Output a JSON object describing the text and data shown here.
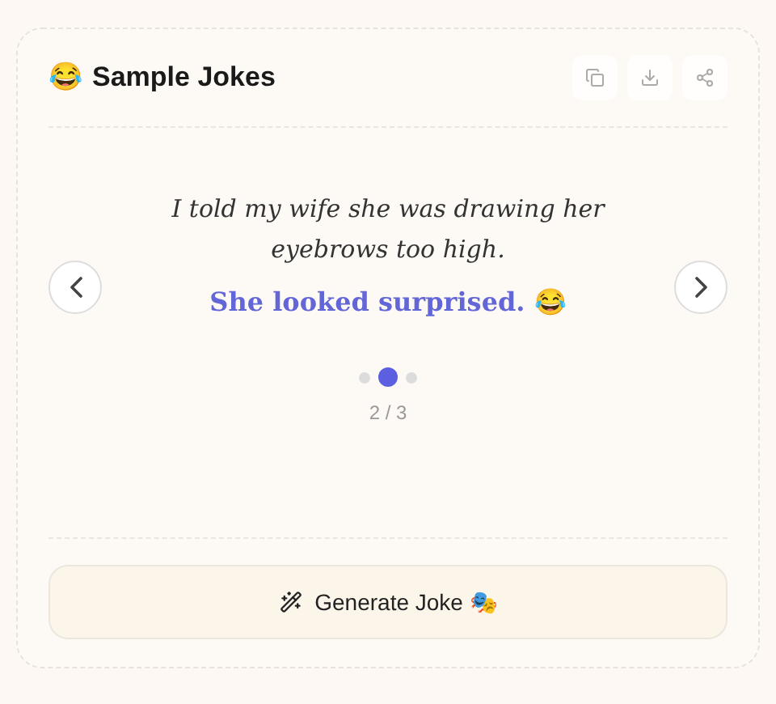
{
  "header": {
    "emoji": "😂",
    "title": "Sample Jokes"
  },
  "joke": {
    "setup": "I told my wife she was drawing her eyebrows too high.",
    "punchline": "She looked surprised. 😂"
  },
  "dots": [
    {
      "selected": false
    },
    {
      "selected": true
    },
    {
      "selected": false
    }
  ],
  "counter": "2 / 3",
  "generate_button": {
    "label": "Generate Joke 🎭"
  }
}
